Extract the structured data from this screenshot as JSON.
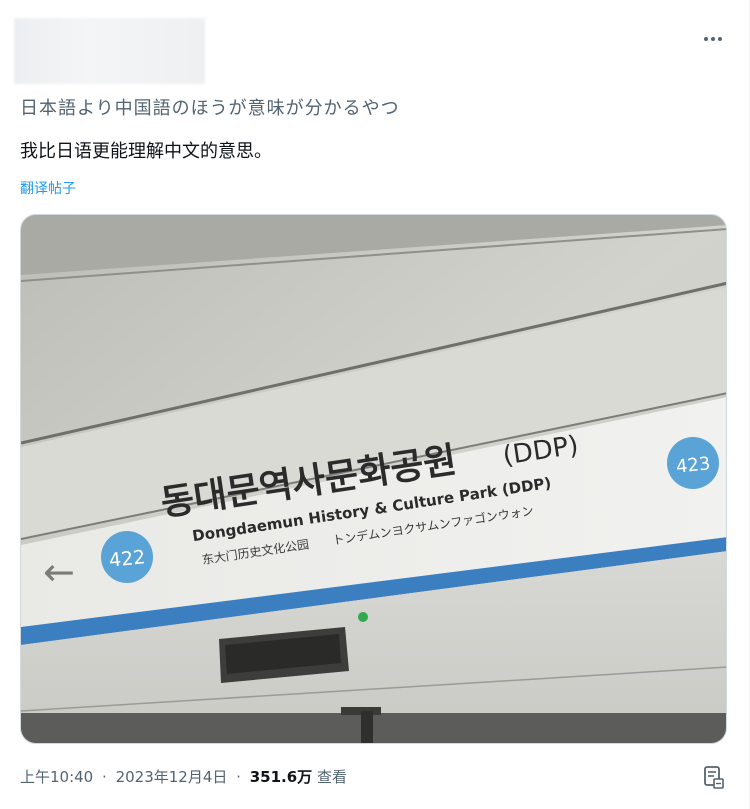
{
  "tweet": {
    "original_text": "日本語より中国語のほうが意味が分かるやつ",
    "translated_text": "我比日语更能理解中文的意思。",
    "translate_link": "翻译帖子",
    "time": "上午10:40",
    "date": "2023年12月4日",
    "views": "351.6万",
    "views_label": "查看"
  },
  "photo": {
    "station_korean": "동대문역사문화공원",
    "station_ddp": "(DDP)",
    "station_english": "Dongdaemun History & Culture Park (DDP)",
    "station_chinese": "东大门历史文化公园",
    "station_japanese": "トンデムンヨクサムンファゴンウォン",
    "number_current": "422",
    "number_next": "423",
    "arrow": "←"
  },
  "colors": {
    "accent": "#1d9bf0",
    "secondary_text": "#536471",
    "line_blue": "#3c7fc1",
    "badge_blue": "#5aa3d6"
  },
  "icons": {
    "more": "more-dots-icon",
    "bookmark": "bookmark-icon",
    "arrow": "left-arrow-icon"
  }
}
